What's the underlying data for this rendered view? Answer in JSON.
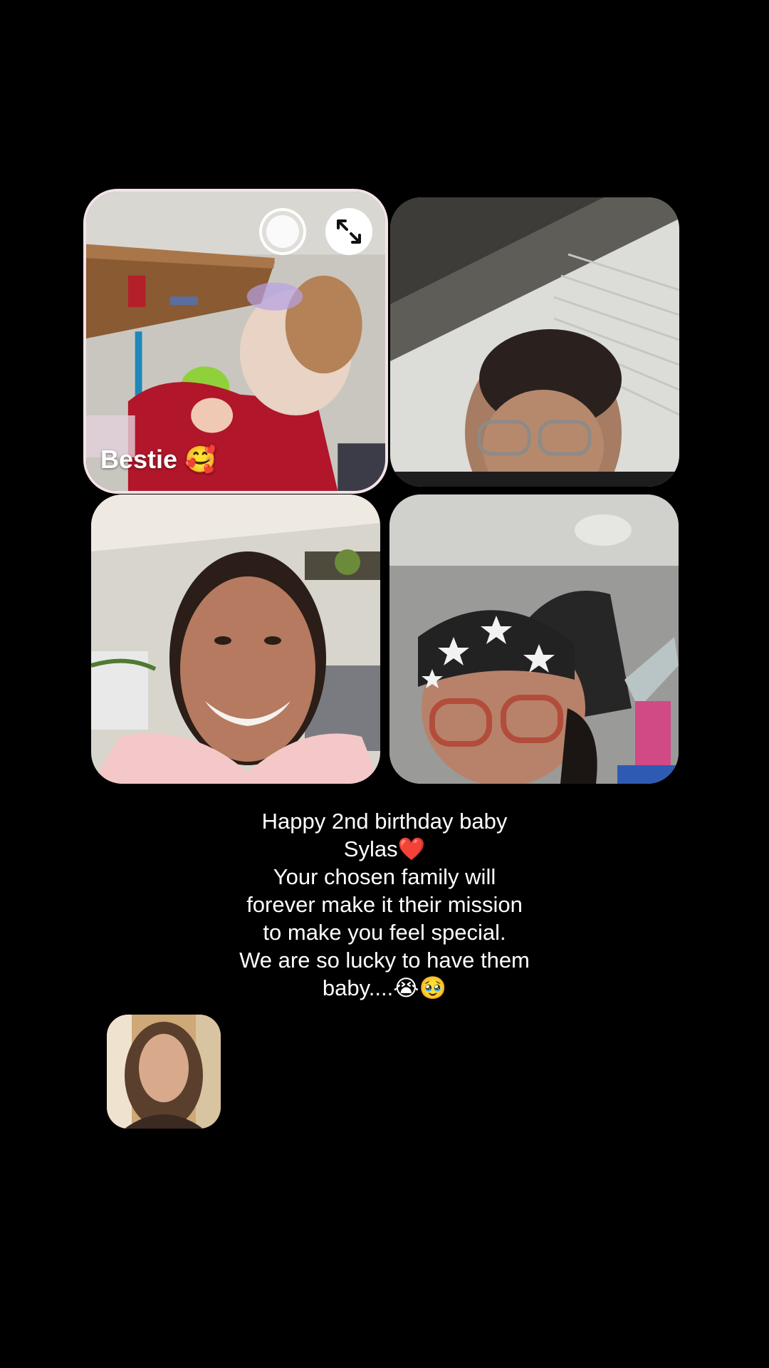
{
  "call": {
    "participants": [
      {
        "label": "Bestie 🥰"
      },
      {
        "label": ""
      },
      {
        "label": ""
      },
      {
        "label": ""
      }
    ],
    "self_view": {
      "label": ""
    },
    "controls": {
      "record_icon": "record-circle-icon",
      "expand_icon": "expand-arrows-icon"
    }
  },
  "caption": {
    "lines": [
      "Happy 2nd birthday baby",
      "Sylas❤️",
      "Your chosen family will",
      "forever make it their mission",
      "to make you feel special.",
      "We are so lucky to have them",
      "baby....😭🥹"
    ]
  },
  "colors": {
    "background": "#000000",
    "tile_border": "#f3e3e7",
    "text": "#ffffff"
  }
}
